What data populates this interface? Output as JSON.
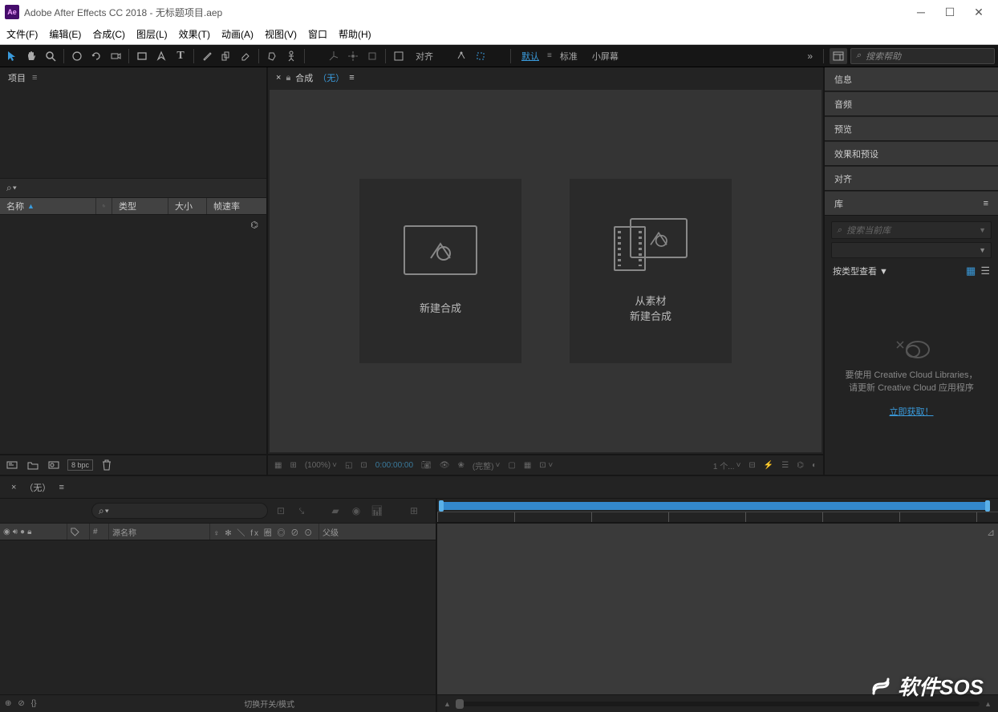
{
  "titlebar": {
    "icon_text": "Ae",
    "title": "Adobe After Effects CC 2018 - 无标题项目.aep"
  },
  "menubar": [
    "文件(F)",
    "编辑(E)",
    "合成(C)",
    "图层(L)",
    "效果(T)",
    "动画(A)",
    "视图(V)",
    "窗口",
    "帮助(H)"
  ],
  "toolbar": {
    "snap_label": "对齐",
    "workspace_default": "默认",
    "workspace_standard": "标准",
    "workspace_small": "小屏幕",
    "search_placeholder": "搜索帮助"
  },
  "project": {
    "tab": "项目",
    "columns": {
      "name": "名称",
      "type": "类型",
      "size": "大小",
      "fps": "帧速率"
    },
    "footer": {
      "bpc": "8 bpc"
    }
  },
  "composition": {
    "tab_prefix": "合成",
    "tab_none": "（无）",
    "card_new": "新建合成",
    "card_from_line1": "从素材",
    "card_from_line2": "新建合成",
    "controls": {
      "zoom": "(100%)",
      "time": "0:00:00:00",
      "full": "(完整)",
      "views": "1 个..."
    }
  },
  "right_panels": {
    "info": "信息",
    "audio": "音频",
    "preview": "预览",
    "effects": "效果和预设",
    "align": "对齐",
    "library": "库",
    "lib_search": "搜索当前库",
    "lib_viewby": "按类型查看",
    "cc_line1": "要使用 Creative Cloud Libraries，",
    "cc_line2": "请更新 Creative Cloud 应用程序",
    "cc_link": "立即获取！"
  },
  "timeline": {
    "tab": "（无）",
    "header": {
      "num": "#",
      "source": "源名称",
      "switches": "♀ ✻ ＼ fx 圈 ◎ ⊘ ⊙",
      "parent": "父级"
    },
    "footer_toggle": "切换开关/模式"
  },
  "watermark": "软件SOS"
}
